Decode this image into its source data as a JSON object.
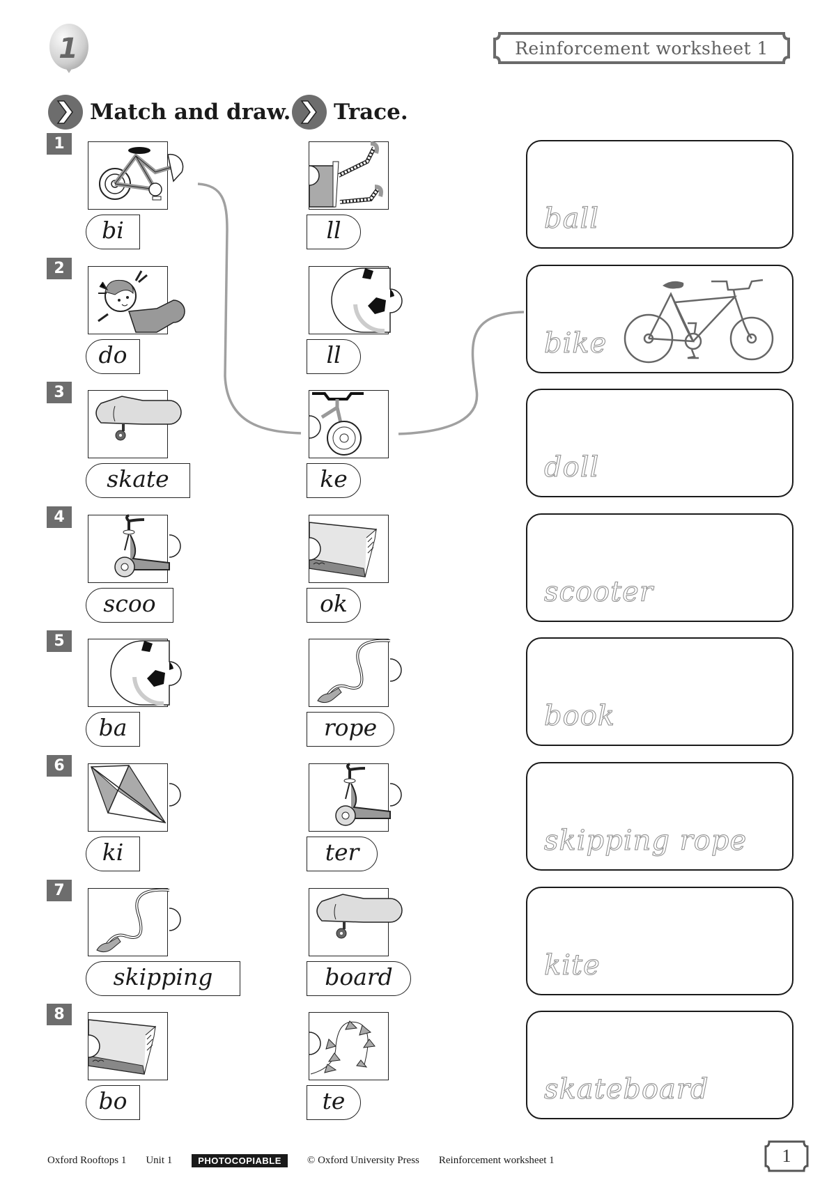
{
  "header": {
    "unit_number": "1",
    "worksheet_title": "Reinforcement worksheet 1"
  },
  "instructions": [
    {
      "label": "Match and draw."
    },
    {
      "label": "Trace."
    }
  ],
  "rows": [
    {
      "number": "1",
      "left_picture": "bike-front-half",
      "left_syllable": "bi",
      "right_picture": "doll-legs-half",
      "right_syllable": "ll"
    },
    {
      "number": "2",
      "left_picture": "doll-head-half",
      "left_syllable": "do",
      "right_picture": "ball-half",
      "right_syllable": "ll"
    },
    {
      "number": "3",
      "left_picture": "skateboard-half",
      "left_syllable": "skate",
      "right_picture": "bike-rear-half",
      "right_syllable": "ke"
    },
    {
      "number": "4",
      "left_picture": "scooter-half",
      "left_syllable": "scoo",
      "right_picture": "book-half",
      "right_syllable": "ok"
    },
    {
      "number": "5",
      "left_picture": "ball-half",
      "left_syllable": "ba",
      "right_picture": "rope-half",
      "right_syllable": "rope"
    },
    {
      "number": "6",
      "left_picture": "kite-half",
      "left_syllable": "ki",
      "right_picture": "scooter-half",
      "right_syllable": "ter"
    },
    {
      "number": "7",
      "left_picture": "rope-half",
      "left_syllable": "skipping",
      "right_picture": "skateboard-half",
      "right_syllable": "board"
    },
    {
      "number": "8",
      "left_picture": "book-half",
      "left_syllable": "bo",
      "right_picture": "kite-tail-half",
      "right_syllable": "te"
    }
  ],
  "trace_words": [
    {
      "word": "ball",
      "has_example_drawing": false
    },
    {
      "word": "bike",
      "has_example_drawing": true,
      "drawing": "bike-icon"
    },
    {
      "word": "doll",
      "has_example_drawing": false
    },
    {
      "word": "scooter",
      "has_example_drawing": false
    },
    {
      "word": "book",
      "has_example_drawing": false
    },
    {
      "word": "skipping rope",
      "has_example_drawing": false
    },
    {
      "word": "kite",
      "has_example_drawing": false
    },
    {
      "word": "skateboard",
      "has_example_drawing": false
    }
  ],
  "example_match": {
    "from_row": 1,
    "to_row": 3,
    "to_trace": "bike"
  },
  "footer": {
    "book": "Oxford Rooftops 1",
    "unit": "Unit 1",
    "badge": "PHOTOCOPIABLE",
    "copyright": "© Oxford University Press",
    "worksheet": "Reinforcement worksheet 1",
    "page_number": "1"
  },
  "colors": {
    "badge_gray": "#6d6d6d",
    "line_gray": "#a0a0a0",
    "ink": "#1a1a1a",
    "trace_dots": "#8a8a8a"
  }
}
